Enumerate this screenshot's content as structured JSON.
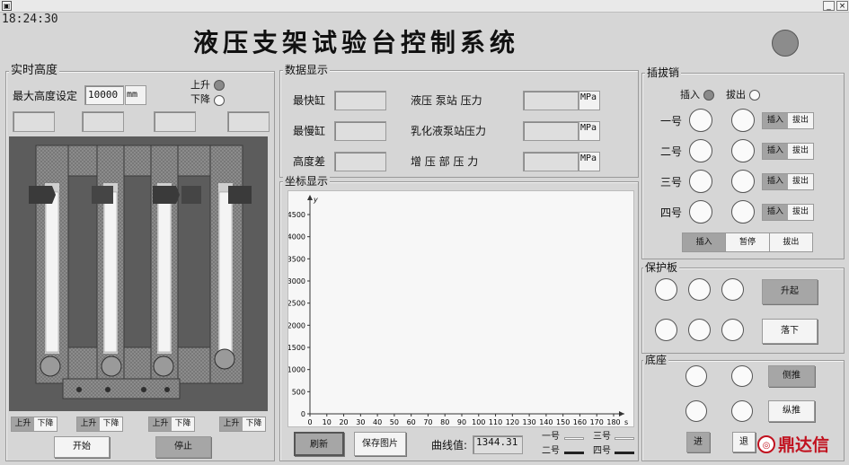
{
  "window": {
    "icon_glyph": "▣",
    "min_label": "_",
    "close_label": "×"
  },
  "clock": "18:24:30",
  "title": "液压支架试验台控制系统",
  "status_lamp_color": "#8c8c8c",
  "realtime": {
    "label": "实时高度",
    "max_height_label": "最大高度设定",
    "max_height_value": "10000",
    "max_height_unit": "mm",
    "up_label": "上升",
    "down_label": "下降",
    "up_selected": true,
    "down_selected": false,
    "controls": [
      {
        "up": "上升",
        "down": "下降"
      },
      {
        "up": "上升",
        "down": "下降"
      },
      {
        "up": "上升",
        "down": "下降"
      },
      {
        "up": "上升",
        "down": "下降"
      }
    ],
    "start_label": "开始",
    "stop_label": "停止"
  },
  "data_display": {
    "label": "数据显示",
    "rows": [
      {
        "left_label": "最快缸",
        "right_label": "液压 泵站 压力",
        "unit": "MPa"
      },
      {
        "left_label": "最慢缸",
        "right_label": "乳化液泵站压力",
        "unit": "MPa"
      },
      {
        "left_label": "高度差",
        "right_label": "增 压 部 压 力",
        "unit": "MPa"
      }
    ]
  },
  "coordinate": {
    "label": "坐标显示",
    "refresh_label": "刷新",
    "save_label": "保存图片",
    "curve_value_label": "曲线值:",
    "curve_value": "1344.31",
    "legend": [
      "一号",
      "二号",
      "三号",
      "四号"
    ]
  },
  "chart_data": {
    "type": "line",
    "xlabel": "s",
    "ylabel": "y",
    "xlim": [
      0,
      180
    ],
    "ylim": [
      0,
      4500
    ],
    "xticks": [
      0,
      10,
      20,
      30,
      40,
      50,
      60,
      70,
      80,
      90,
      100,
      110,
      120,
      130,
      140,
      150,
      160,
      170,
      180
    ],
    "yticks": [
      0,
      500,
      1000,
      1500,
      2000,
      2500,
      3000,
      3500,
      4000,
      4500
    ],
    "series": [
      {
        "name": "一号",
        "values": []
      },
      {
        "name": "二号",
        "values": []
      },
      {
        "name": "三号",
        "values": []
      },
      {
        "name": "四号",
        "values": []
      }
    ]
  },
  "pins": {
    "label": "插拔销",
    "insert_label": "插入",
    "extract_label": "拔出",
    "insert_selected": true,
    "rows": [
      {
        "label": "一号",
        "insert": "插入",
        "extract": "拔出"
      },
      {
        "label": "二号",
        "insert": "插入",
        "extract": "拔出"
      },
      {
        "label": "三号",
        "insert": "插入",
        "extract": "拔出"
      },
      {
        "label": "四号",
        "insert": "插入",
        "extract": "拔出"
      }
    ],
    "all_insert": "插入",
    "pause": "暂停",
    "all_extract": "拔出"
  },
  "guard": {
    "label": "保护板",
    "raise_label": "升起",
    "lower_label": "落下"
  },
  "base": {
    "label": "底座",
    "side_label": "侧推",
    "long_label": "纵推",
    "forward_label": "进",
    "back_label": "退"
  },
  "watermark": "鼎达信"
}
